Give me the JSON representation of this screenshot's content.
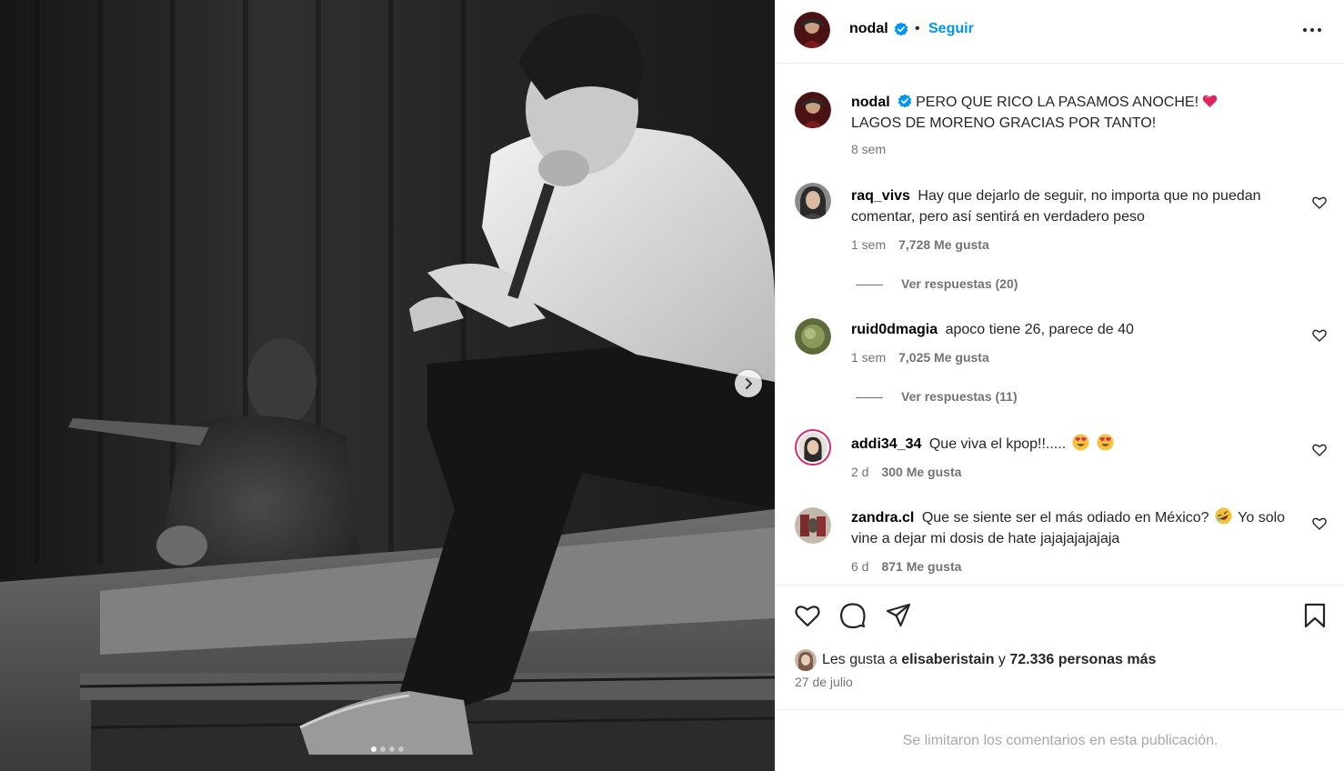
{
  "post": {
    "author": "nodal",
    "follow_label": "Seguir",
    "separator": "•",
    "caption_line1": "PERO QUE RICO LA PASAMOS ANOCHE!",
    "caption_line2": "LAGOS DE MORENO GRACIAS POR TANTO!",
    "caption_time": "8 sem",
    "carousel_count": 4,
    "carousel_active": 1
  },
  "comments": [
    {
      "user": "raq_vivs",
      "text": "Hay que dejarlo de seguir, no importa que no puedan comentar, pero así sentirá en verdadero peso",
      "time": "1 sem",
      "likes": "7,728 Me gusta",
      "replies": "Ver respuestas (20)"
    },
    {
      "user": "ruid0dmagia",
      "text": "apoco tiene 26, parece de 40",
      "time": "1 sem",
      "likes": "7,025 Me gusta",
      "replies": "Ver respuestas (11)"
    },
    {
      "user": "addi34_34",
      "text": "Que viva el kpop!!.....",
      "time": "2 d",
      "likes": "300 Me gusta"
    },
    {
      "user": "zandra.cl",
      "text": "Que se siente ser el más odiado en México?",
      "text_tail": "Yo solo vine a dejar mi dosis de hate jajajajajajaja",
      "time": "6 d",
      "likes": "871 Me gusta"
    }
  ],
  "likes_summary": {
    "prefix": "Les gusta a",
    "user": "elisaberistain",
    "connector": "y",
    "others": "72.336 personas más"
  },
  "post_date": "27 de julio",
  "comments_limited": "Se limitaron los comentarios en esta publicación.",
  "icons": [
    "verified-badge-icon",
    "more-options-icon",
    "heart-icon",
    "comment-icon",
    "share-icon",
    "bookmark-icon",
    "chevron-right-icon"
  ],
  "colors": {
    "link_blue": "#0095f6",
    "verified_blue": "#0095f6",
    "muted": "#737373",
    "border": "#efefef"
  }
}
